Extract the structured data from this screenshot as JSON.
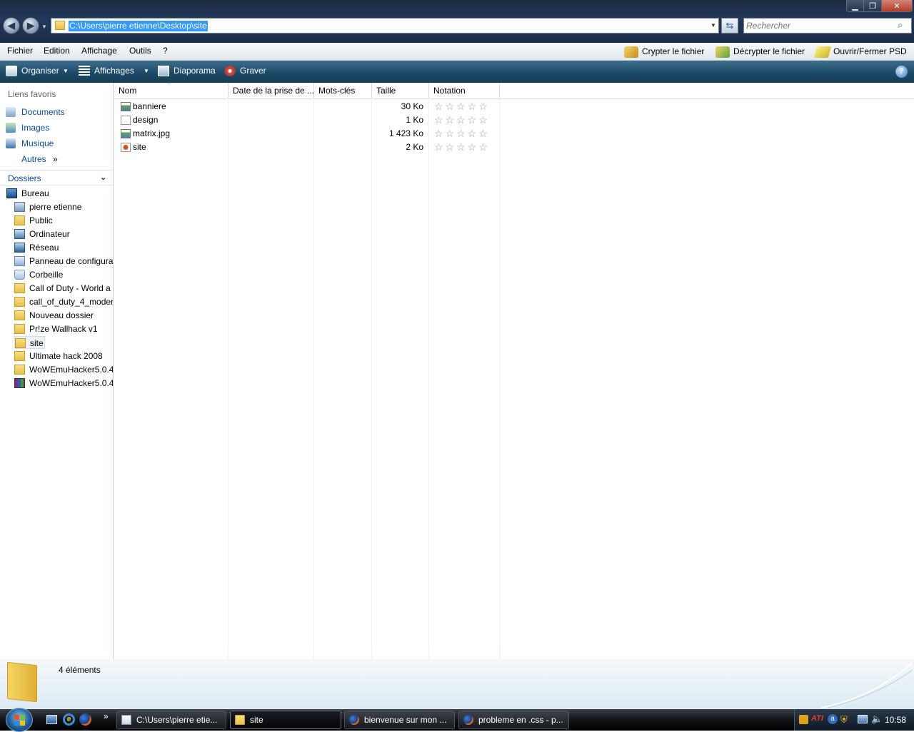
{
  "address": {
    "path": "C:\\Users\\pierre etienne\\Desktop\\site"
  },
  "search": {
    "placeholder": "Rechercher"
  },
  "menubar": {
    "items": [
      "Fichier",
      "Edition",
      "Affichage",
      "Outils",
      "?"
    ],
    "actions": [
      "Crypter le fichier",
      "Décrypter le fichier",
      "Ouvrir/Fermer PSD"
    ]
  },
  "toolbar": {
    "organize": "Organiser",
    "views": "Affichages",
    "slideshow": "Diaporama",
    "burn": "Graver"
  },
  "nav": {
    "favorites_title": "Liens favoris",
    "favorites": [
      "Documents",
      "Images",
      "Musique",
      "Autres"
    ],
    "folders_title": "Dossiers",
    "tree_root": "Bureau",
    "tree": [
      {
        "label": "pierre etienne",
        "icon": "user-folder-icon"
      },
      {
        "label": "Public",
        "icon": "folder-icon"
      },
      {
        "label": "Ordinateur",
        "icon": "computer-icon"
      },
      {
        "label": "Réseau",
        "icon": "network-icon"
      },
      {
        "label": "Panneau de configura",
        "icon": "control-panel-icon"
      },
      {
        "label": "Corbeille",
        "icon": "recycle-bin-icon"
      },
      {
        "label": "Call of Duty - World a",
        "icon": "folder-icon"
      },
      {
        "label": "call_of_duty_4_moder",
        "icon": "folder-icon"
      },
      {
        "label": "Nouveau dossier",
        "icon": "folder-icon"
      },
      {
        "label": "Pr!ze Wallhack v1",
        "icon": "folder-icon"
      },
      {
        "label": "site",
        "icon": "folder-icon"
      },
      {
        "label": "Ultimate hack 2008",
        "icon": "folder-icon"
      },
      {
        "label": "WoWEmuHacker5.0.4",
        "icon": "folder-icon"
      },
      {
        "label": "WoWEmuHacker5.0.4",
        "icon": "rar-archive-icon"
      }
    ]
  },
  "columns": [
    "Nom",
    "Date de la prise de ...",
    "Mots-clés",
    "Taille",
    "Notation"
  ],
  "files": [
    {
      "name": "banniere",
      "size": "30 Ko",
      "icon": "image-file-icon"
    },
    {
      "name": "design",
      "size": "1 Ko",
      "icon": "css-file-icon"
    },
    {
      "name": "matrix.jpg",
      "size": "1 423 Ko",
      "icon": "image-file-icon"
    },
    {
      "name": "site",
      "size": "2 Ko",
      "icon": "html-file-icon"
    }
  ],
  "details": {
    "count": "4 éléments"
  },
  "taskbar": {
    "tasks": [
      "C:\\Users\\pierre etie...",
      "site",
      "bienvenue sur mon ...",
      "probleme en .css - p..."
    ],
    "clock": "10:58"
  }
}
